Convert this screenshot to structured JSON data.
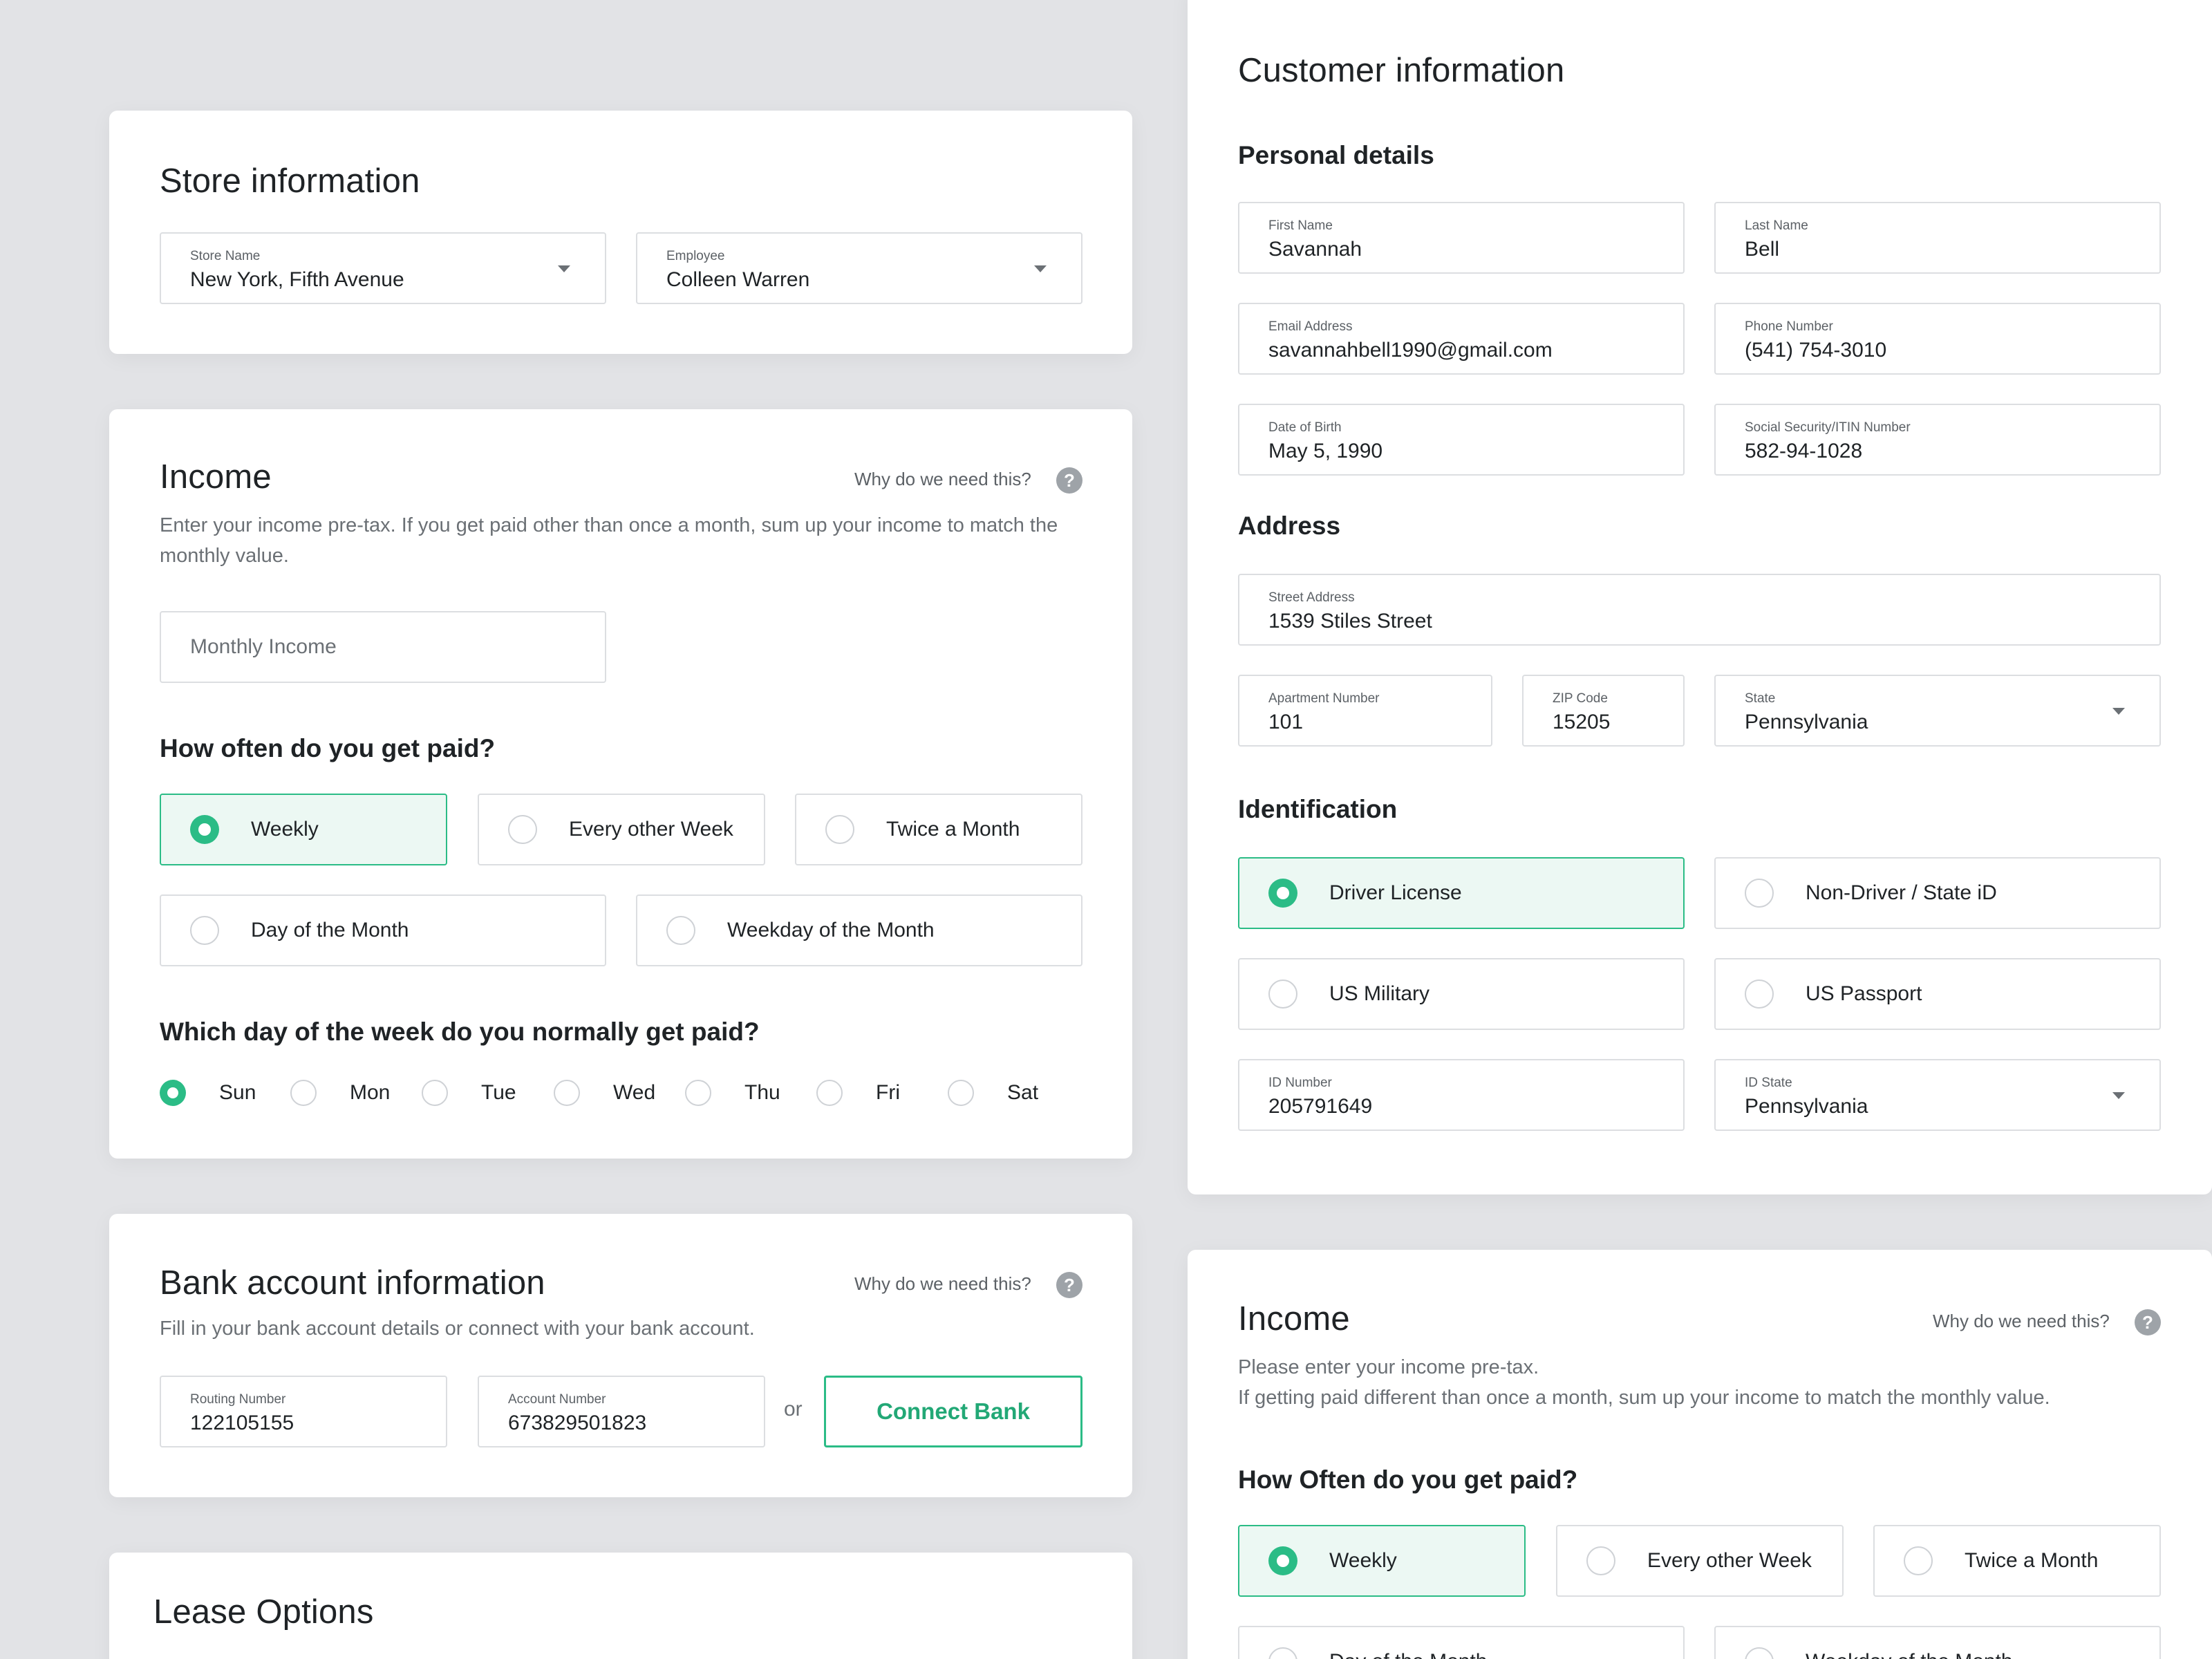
{
  "store": {
    "title": "Store information",
    "store_name_label": "Store Name",
    "store_name_value": "New York, Fifth Avenue",
    "employee_label": "Employee",
    "employee_value": "Colleen Warren"
  },
  "income": {
    "title": "Income",
    "why": "Why do we need this?",
    "description": "Enter your income pre-tax. If you get paid other than once a month, sum up your income to match the monthly value.",
    "monthly_placeholder": "Monthly Income",
    "frequency_title": "How often do you get paid?",
    "frequency_options": [
      "Weekly",
      "Every other Week",
      "Twice a Month",
      "Day of the Month",
      "Weekday of the Month"
    ],
    "frequency_selected": "Weekly",
    "weekday_title": "Which day of the week do you normally get paid?",
    "weekdays": [
      "Sun",
      "Mon",
      "Tue",
      "Wed",
      "Thu",
      "Fri",
      "Sat"
    ],
    "weekday_selected": "Sun"
  },
  "bank": {
    "title": "Bank account information",
    "why": "Why do we need this?",
    "description": "Fill in your bank account details or connect with your bank account.",
    "routing_label": "Routing Number",
    "routing_value": "122105155",
    "account_label": "Account Number",
    "account_value": "673829501823",
    "or": "or",
    "connect_label": "Connect Bank"
  },
  "lease": {
    "title": "Lease Options"
  },
  "customer": {
    "title": "Customer information",
    "personal_title": "Personal details",
    "first_name_label": "First Name",
    "first_name_value": "Savannah",
    "last_name_label": "Last Name",
    "last_name_value": "Bell",
    "email_label": "Email Address",
    "email_value": "savannahbell1990@gmail.com",
    "phone_label": "Phone Number",
    "phone_value": "(541) 754-3010",
    "dob_label": "Date of Birth",
    "dob_value": "May 5, 1990",
    "ssn_label": "Social Security/ITIN Number",
    "ssn_value": "582-94-1028",
    "address_title": "Address",
    "street_label": "Street Address",
    "street_value": "1539 Stiles Street",
    "apt_label": "Apartment Number",
    "apt_value": "101",
    "zip_label": "ZIP Code",
    "zip_value": "15205",
    "state_label": "State",
    "state_value": "Pennsylvania",
    "identification_title": "Identification",
    "id_options": [
      "Driver License",
      "Non-Driver / State iD",
      "US Military",
      "US Passport"
    ],
    "id_selected": "Driver License",
    "id_number_label": "ID Number",
    "id_number_value": "205791649",
    "id_state_label": "ID State",
    "id_state_value": "Pennsylvania"
  },
  "income2": {
    "title": "Income",
    "why": "Why do we need this?",
    "description_line1": "Please enter your income pre-tax.",
    "description_line2": "If getting paid different than once a month, sum up your income to match the monthly value.",
    "frequency_title": "How Often do you get paid?",
    "frequency_options": [
      "Weekly",
      "Every other Week",
      "Twice a Month",
      "Day of the Month",
      "Weekday of the Month"
    ],
    "frequency_selected": "Weekly"
  },
  "colors": {
    "accent": "#2bbc86",
    "selected_bg": "#ecf8f3",
    "page_bg": "#e2e3e6"
  }
}
